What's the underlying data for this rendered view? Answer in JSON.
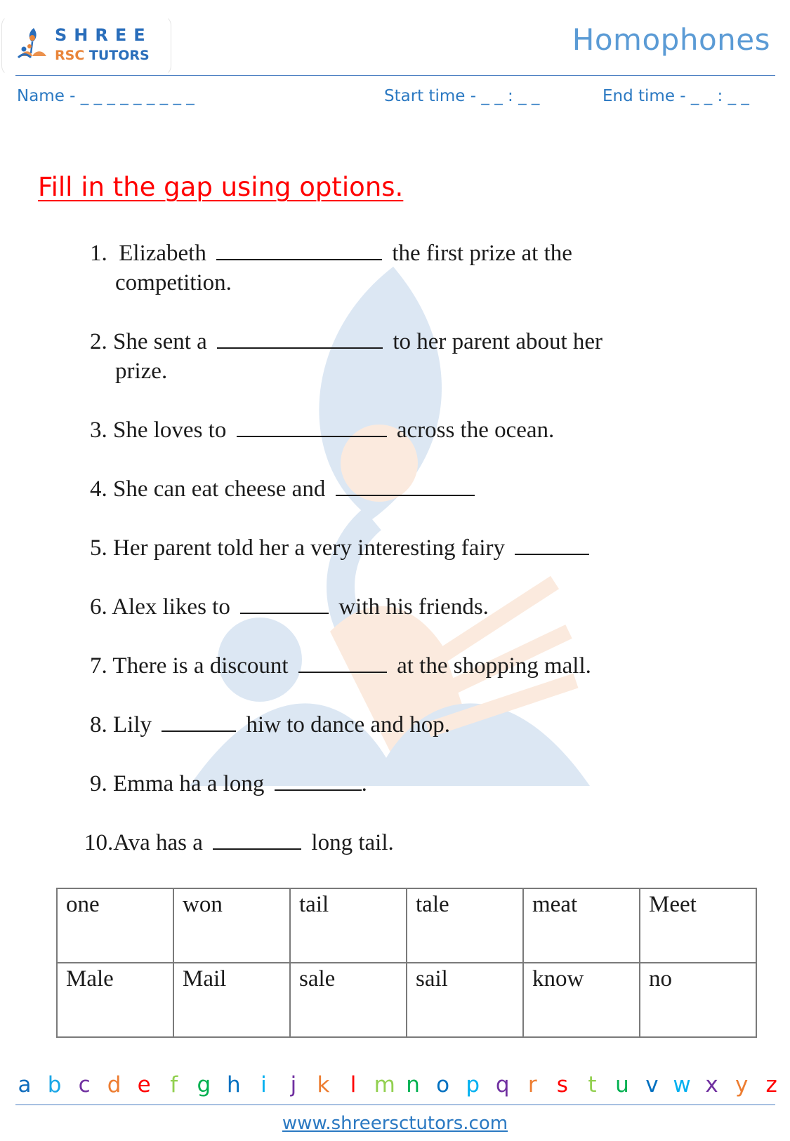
{
  "header": {
    "logo": {
      "line1": "SHREE",
      "line2a": "RSC",
      "line2b": " TUTORS",
      "icon": "shree-rsc-logo-icon"
    },
    "title": "Homophones",
    "name_label": "Name - _ _ _ _ _ _ _ _ _",
    "start_time_label": "Start time - _ _ : _ _",
    "end_time_label": "End time - _ _ : _ _"
  },
  "instruction": "Fill in the gap using options.",
  "questions": [
    {
      "num": "1.",
      "before": "Elizabeth",
      "after": "the first prize at the",
      "continuation": "competition."
    },
    {
      "num": "2.",
      "before": "She sent a",
      "after": "to her parent about her",
      "continuation": "prize."
    },
    {
      "num": "3.",
      "before": "She loves to",
      "after": "across the ocean.",
      "continuation": ""
    },
    {
      "num": "4.",
      "before": "She can eat cheese and",
      "after": "",
      "continuation": ""
    },
    {
      "num": "5.",
      "before": "Her parent told her a very interesting fairy",
      "after": "",
      "continuation": ""
    },
    {
      "num": "6.",
      "before": "Alex likes to",
      "after": "with his friends.",
      "continuation": ""
    },
    {
      "num": "7.",
      "before": "There is a discount",
      "after": "at the shopping mall.",
      "continuation": ""
    },
    {
      "num": "8.",
      "before": "Lily",
      "after": "hiw to dance and hop.",
      "continuation": ""
    },
    {
      "num": "9.",
      "before": "Emma ha a long",
      "after": ".",
      "continuation": ""
    },
    {
      "num": "10.",
      "before": "Ava has a",
      "after": "long tail.",
      "continuation": ""
    }
  ],
  "options_table": {
    "rows": [
      [
        "one",
        "won",
        "tail",
        "tale",
        "meat",
        "Meet"
      ],
      [
        "Male",
        "Mail",
        "sale",
        "sail",
        "know",
        "no"
      ]
    ]
  },
  "footer": {
    "alphabet": [
      {
        "ch": "a",
        "color": "#0f6cbd"
      },
      {
        "ch": "b",
        "color": "#1aa6e6"
      },
      {
        "ch": "c",
        "color": "#7030a0"
      },
      {
        "ch": "d",
        "color": "#ed7d31"
      },
      {
        "ch": "e",
        "color": "#ff0000"
      },
      {
        "ch": "f",
        "color": "#92d050"
      },
      {
        "ch": "g",
        "color": "#00b050"
      },
      {
        "ch": "h",
        "color": "#0070c0"
      },
      {
        "ch": "i",
        "color": "#00b0f0"
      },
      {
        "ch": "j",
        "color": "#7030a0"
      },
      {
        "ch": "k",
        "color": "#ed7d31"
      },
      {
        "ch": "l",
        "color": "#ff0000"
      },
      {
        "ch": "m",
        "color": "#92d050"
      },
      {
        "ch": "n",
        "color": "#00b050"
      },
      {
        "ch": "o",
        "color": "#0070c0"
      },
      {
        "ch": "p",
        "color": "#00b0f0"
      },
      {
        "ch": "q",
        "color": "#7030a0"
      },
      {
        "ch": "r",
        "color": "#ed7d31"
      },
      {
        "ch": "s",
        "color": "#ff0000"
      },
      {
        "ch": "t",
        "color": "#92d050"
      },
      {
        "ch": "u",
        "color": "#00b050"
      },
      {
        "ch": "v",
        "color": "#0070c0"
      },
      {
        "ch": "w",
        "color": "#00b0f0"
      },
      {
        "ch": "x",
        "color": "#7030a0"
      },
      {
        "ch": "y",
        "color": "#ed7d31"
      },
      {
        "ch": "z",
        "color": "#ff0000"
      }
    ],
    "website": "www.shreersctutors.com"
  },
  "colors": {
    "title_blue": "#5b9bd5",
    "meta_blue": "#2b79c2",
    "instruction_red": "#ff0000",
    "logo_blue": "#2a6ebb",
    "logo_orange": "#e9853a"
  }
}
